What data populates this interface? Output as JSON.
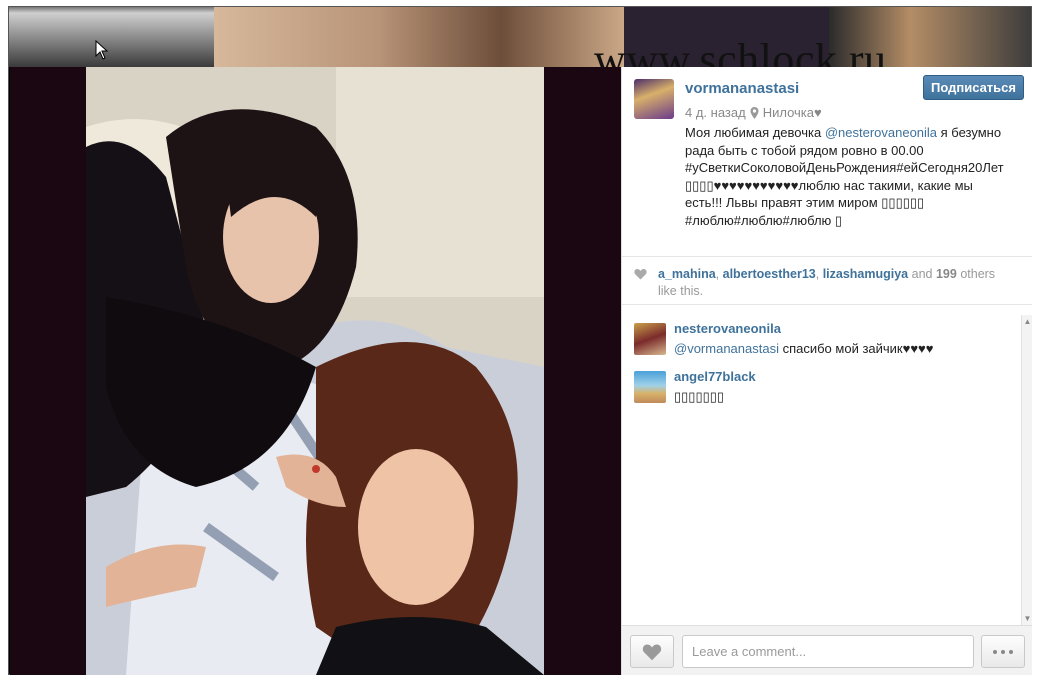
{
  "watermark": "www.schlock.ru",
  "post": {
    "username": "vormananastasi",
    "follow_label": "Подписаться",
    "time_ago": "4 д. назад",
    "location": "Нилочка♥",
    "caption_parts": {
      "p1": "Моя любимая девочка ",
      "mention": "@nesterovaneonila",
      "p2": " я безумно рада быть с тобой рядом ровно в 00.00 #уСветкиСоколовойДеньРождения#ейСегодня20Лет▯▯▯▯♥♥♥♥♥♥♥♥♥♥♥люблю нас такими, какие мы есть!!! Львы правят этим миром ▯▯▯▯▯▯ #люблю#люблю#люблю ▯"
    }
  },
  "likes": {
    "users": [
      "a_mahina",
      "albertoesther13",
      "lizashamugiya"
    ],
    "and_label": "and",
    "count": "199",
    "suffix": "others like this."
  },
  "comments": [
    {
      "user": "nesterovaneonila",
      "mention": "@vormananastasi",
      "text": " спасибо мой зайчик♥♥♥♥"
    },
    {
      "user": "angel77black",
      "mention": "",
      "text": "▯▯▯▯▯▯▯"
    }
  ],
  "comment_box": {
    "placeholder": "Leave a comment..."
  },
  "icons": {
    "like": "heart-icon",
    "more": "ellipsis-icon",
    "location": "map-pin-icon"
  },
  "colors": {
    "link": "#3f729b",
    "follow_btn": "#3f729b",
    "photo_bg": "#1a0712"
  }
}
